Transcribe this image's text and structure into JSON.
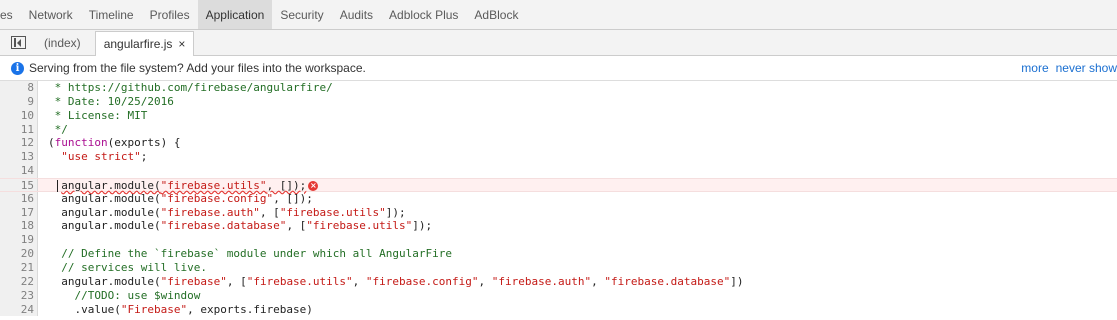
{
  "top_tabs": [
    "rces",
    "Network",
    "Timeline",
    "Profiles",
    "Application",
    "Security",
    "Audits",
    "Adblock Plus",
    "AdBlock"
  ],
  "top_tabs_active_index": 4,
  "file_tabs": {
    "index_label": "(index)",
    "active_label": "angularfire.js",
    "close_glyph": "×"
  },
  "infobar": {
    "icon_glyph": "i",
    "message": "Serving from the file system? Add your files into the workspace.",
    "more_label": "more",
    "never_show_label": "never show"
  },
  "editor": {
    "lines": [
      {
        "num": "8",
        "segments": [
          {
            "t": " * https://github.com/firebase/angularfire/",
            "c": "comment"
          }
        ]
      },
      {
        "num": "9",
        "segments": [
          {
            "t": " * Date: 10/25/2016",
            "c": "comment"
          }
        ]
      },
      {
        "num": "10",
        "segments": [
          {
            "t": " * License: MIT",
            "c": "comment"
          }
        ]
      },
      {
        "num": "11",
        "segments": [
          {
            "t": " */",
            "c": "comment"
          }
        ]
      },
      {
        "num": "12",
        "segments": [
          {
            "t": "(",
            "c": ""
          },
          {
            "t": "function",
            "c": "keyword"
          },
          {
            "t": "(exports) {",
            "c": ""
          }
        ]
      },
      {
        "num": "13",
        "segments": [
          {
            "t": "  ",
            "c": ""
          },
          {
            "t": "\"use strict\"",
            "c": "string"
          },
          {
            "t": ";",
            "c": ""
          }
        ]
      },
      {
        "num": "14",
        "segments": []
      },
      {
        "num": "15",
        "error": true,
        "segments": [
          {
            "t": "  ",
            "c": ""
          },
          {
            "t": "angular.module(",
            "c": "squiggle"
          },
          {
            "t": "\"firebase.utils\"",
            "c": "string squiggle"
          },
          {
            "t": ", []);",
            "c": "squiggle"
          }
        ]
      },
      {
        "num": "16",
        "segments": [
          {
            "t": "  angular.module(",
            "c": ""
          },
          {
            "t": "\"firebase.config\"",
            "c": "string"
          },
          {
            "t": ", []);",
            "c": ""
          }
        ]
      },
      {
        "num": "17",
        "segments": [
          {
            "t": "  angular.module(",
            "c": ""
          },
          {
            "t": "\"firebase.auth\"",
            "c": "string"
          },
          {
            "t": ", [",
            "c": ""
          },
          {
            "t": "\"firebase.utils\"",
            "c": "string"
          },
          {
            "t": "]);",
            "c": ""
          }
        ]
      },
      {
        "num": "18",
        "segments": [
          {
            "t": "  angular.module(",
            "c": ""
          },
          {
            "t": "\"firebase.database\"",
            "c": "string"
          },
          {
            "t": ", [",
            "c": ""
          },
          {
            "t": "\"firebase.utils\"",
            "c": "string"
          },
          {
            "t": "]);",
            "c": ""
          }
        ]
      },
      {
        "num": "19",
        "segments": []
      },
      {
        "num": "20",
        "segments": [
          {
            "t": "  // Define the `firebase` module under which all AngularFire",
            "c": "comment"
          }
        ]
      },
      {
        "num": "21",
        "segments": [
          {
            "t": "  // services will live.",
            "c": "comment"
          }
        ]
      },
      {
        "num": "22",
        "segments": [
          {
            "t": "  angular.module(",
            "c": ""
          },
          {
            "t": "\"firebase\"",
            "c": "string"
          },
          {
            "t": ", [",
            "c": ""
          },
          {
            "t": "\"firebase.utils\"",
            "c": "string"
          },
          {
            "t": ", ",
            "c": ""
          },
          {
            "t": "\"firebase.config\"",
            "c": "string"
          },
          {
            "t": ", ",
            "c": ""
          },
          {
            "t": "\"firebase.auth\"",
            "c": "string"
          },
          {
            "t": ", ",
            "c": ""
          },
          {
            "t": "\"firebase.database\"",
            "c": "string"
          },
          {
            "t": "])",
            "c": ""
          }
        ]
      },
      {
        "num": "23",
        "segments": [
          {
            "t": "    //TODO: use $window",
            "c": "comment"
          }
        ]
      },
      {
        "num": "24",
        "segments": [
          {
            "t": "    .value(",
            "c": ""
          },
          {
            "t": "\"Firebase\"",
            "c": "string"
          },
          {
            "t": ", exports.firebase)",
            "c": ""
          }
        ]
      }
    ],
    "error_icon_glyph": "×"
  }
}
